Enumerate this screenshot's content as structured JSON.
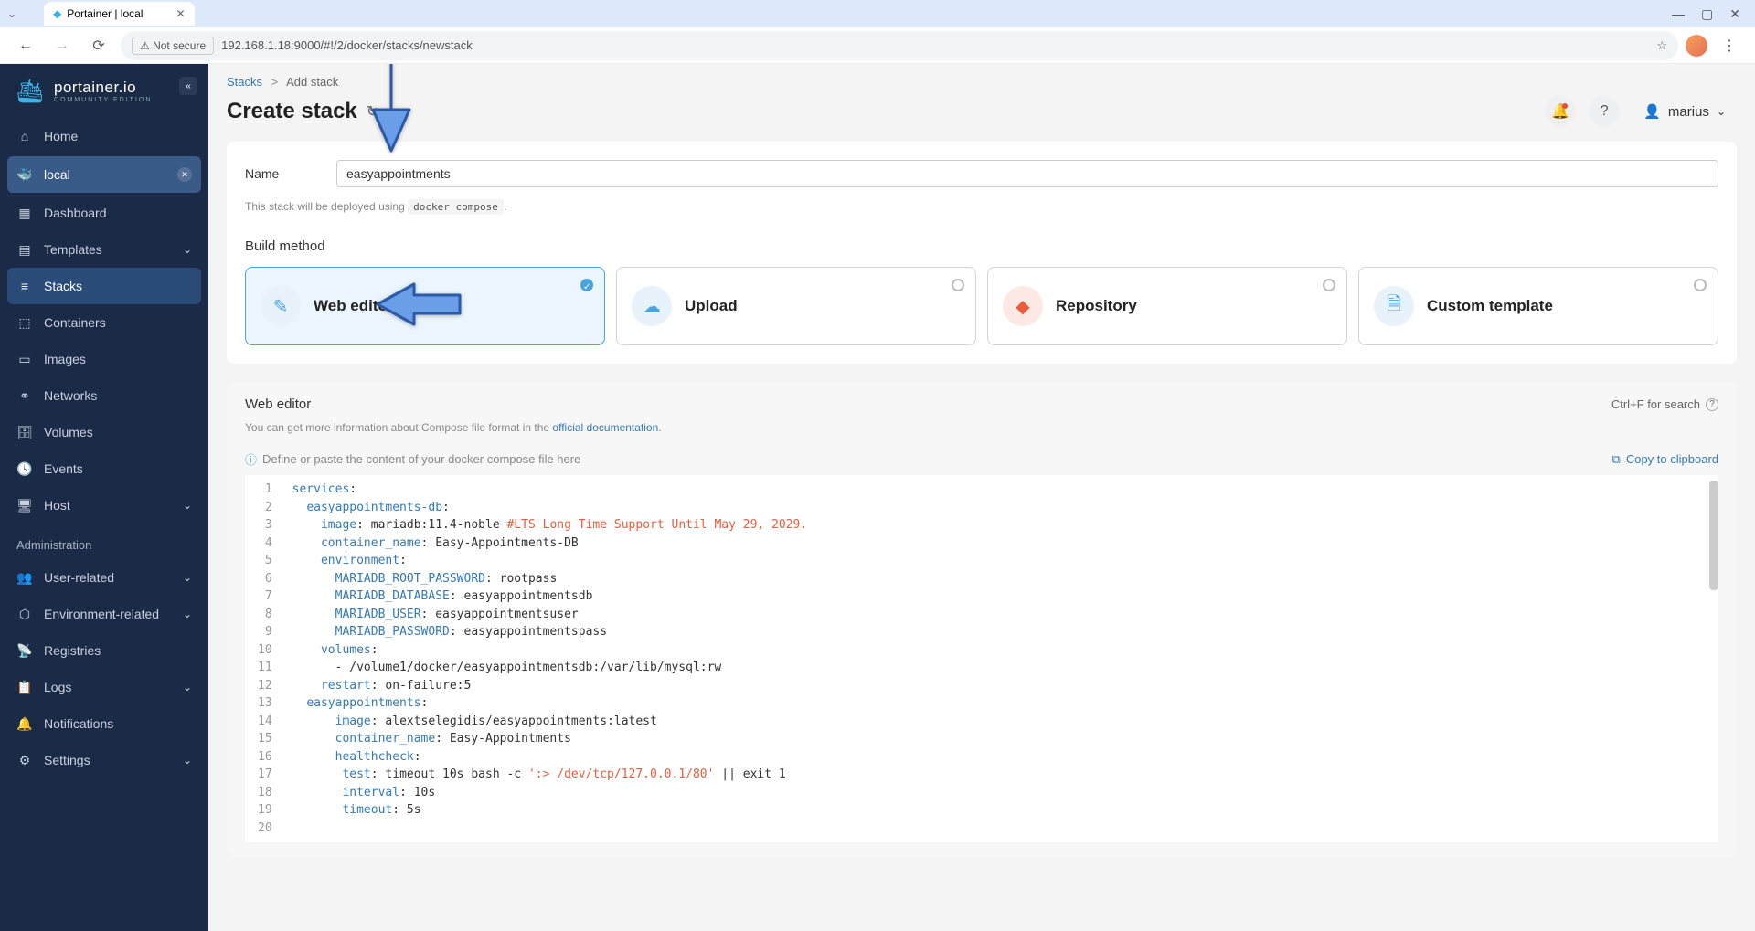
{
  "browser": {
    "tab_title": "Portainer | local",
    "url_label": "Not secure",
    "url": "192.168.1.18:9000/#!/2/docker/stacks/newstack"
  },
  "sidebar": {
    "logo_title": "portainer.io",
    "logo_subtitle": "COMMUNITY EDITION",
    "home": "Home",
    "local": "local",
    "items": [
      {
        "icon": "dashboard-icon",
        "label": "Dashboard"
      },
      {
        "icon": "templates-icon",
        "label": "Templates",
        "chevron": true
      },
      {
        "icon": "stacks-icon",
        "label": "Stacks",
        "active": true
      },
      {
        "icon": "containers-icon",
        "label": "Containers"
      },
      {
        "icon": "images-icon",
        "label": "Images"
      },
      {
        "icon": "networks-icon",
        "label": "Networks"
      },
      {
        "icon": "volumes-icon",
        "label": "Volumes"
      },
      {
        "icon": "events-icon",
        "label": "Events"
      },
      {
        "icon": "host-icon",
        "label": "Host",
        "chevron": true
      }
    ],
    "admin_title": "Administration",
    "admin": [
      {
        "icon": "user-icon",
        "label": "User-related",
        "chevron": true
      },
      {
        "icon": "env-icon",
        "label": "Environment-related",
        "chevron": true
      },
      {
        "icon": "registries-icon",
        "label": "Registries"
      },
      {
        "icon": "logs-icon",
        "label": "Logs",
        "chevron": true
      },
      {
        "icon": "notifications-icon",
        "label": "Notifications"
      },
      {
        "icon": "settings-icon",
        "label": "Settings",
        "chevron": true
      }
    ]
  },
  "breadcrumb": {
    "root": "Stacks",
    "current": "Add stack"
  },
  "page_title": "Create stack",
  "user_name": "marius",
  "form": {
    "name_label": "Name",
    "name_value": "easyappointments",
    "help_pre": "This stack will be deployed using",
    "help_code": "docker compose",
    "help_post": "."
  },
  "build": {
    "label": "Build method",
    "methods": [
      {
        "label": "Web editor",
        "icon": "edit-icon",
        "selected": true
      },
      {
        "label": "Upload",
        "icon": "upload-icon"
      },
      {
        "label": "Repository",
        "icon": "git-icon",
        "git": true
      },
      {
        "label": "Custom template",
        "icon": "template-icon"
      }
    ]
  },
  "editor": {
    "title": "Web editor",
    "search_hint": "Ctrl+F for search",
    "help_pre": "You can get more information about Compose file format in the ",
    "help_link": "official documentation",
    "info": "Define or paste the content of your docker compose file here",
    "copy": "Copy to clipboard",
    "code": [
      [
        {
          "t": "key",
          "v": "services"
        },
        {
          "t": "plain",
          "v": ":"
        }
      ],
      [
        {
          "t": "plain",
          "v": "  "
        },
        {
          "t": "key",
          "v": "easyappointments-db"
        },
        {
          "t": "plain",
          "v": ":"
        }
      ],
      [
        {
          "t": "plain",
          "v": "    "
        },
        {
          "t": "key",
          "v": "image"
        },
        {
          "t": "plain",
          "v": ": mariadb:11.4-noble "
        },
        {
          "t": "comment",
          "v": "#LTS Long Time Support Until May 29, 2029."
        }
      ],
      [
        {
          "t": "plain",
          "v": "    "
        },
        {
          "t": "key",
          "v": "container_name"
        },
        {
          "t": "plain",
          "v": ": Easy-Appointments-DB"
        }
      ],
      [
        {
          "t": "plain",
          "v": "    "
        },
        {
          "t": "key",
          "v": "environment"
        },
        {
          "t": "plain",
          "v": ":"
        }
      ],
      [
        {
          "t": "plain",
          "v": "      "
        },
        {
          "t": "key",
          "v": "MARIADB_ROOT_PASSWORD"
        },
        {
          "t": "plain",
          "v": ": rootpass"
        }
      ],
      [
        {
          "t": "plain",
          "v": "      "
        },
        {
          "t": "key",
          "v": "MARIADB_DATABASE"
        },
        {
          "t": "plain",
          "v": ": easyappointmentsdb"
        }
      ],
      [
        {
          "t": "plain",
          "v": "      "
        },
        {
          "t": "key",
          "v": "MARIADB_USER"
        },
        {
          "t": "plain",
          "v": ": easyappointmentsuser"
        }
      ],
      [
        {
          "t": "plain",
          "v": "      "
        },
        {
          "t": "key",
          "v": "MARIADB_PASSWORD"
        },
        {
          "t": "plain",
          "v": ": easyappointmentspass"
        }
      ],
      [
        {
          "t": "plain",
          "v": "    "
        },
        {
          "t": "key",
          "v": "volumes"
        },
        {
          "t": "plain",
          "v": ":"
        }
      ],
      [
        {
          "t": "plain",
          "v": "      - /volume1/docker/easyappointmentsdb:/var/lib/mysql:rw"
        }
      ],
      [
        {
          "t": "plain",
          "v": "    "
        },
        {
          "t": "key",
          "v": "restart"
        },
        {
          "t": "plain",
          "v": ": on-failure:5"
        }
      ],
      [
        {
          "t": "plain",
          "v": ""
        }
      ],
      [
        {
          "t": "plain",
          "v": "  "
        },
        {
          "t": "key",
          "v": "easyappointments"
        },
        {
          "t": "plain",
          "v": ":"
        }
      ],
      [
        {
          "t": "plain",
          "v": "      "
        },
        {
          "t": "key",
          "v": "image"
        },
        {
          "t": "plain",
          "v": ": alextselegidis/easyappointments:latest"
        }
      ],
      [
        {
          "t": "plain",
          "v": "      "
        },
        {
          "t": "key",
          "v": "container_name"
        },
        {
          "t": "plain",
          "v": ": Easy-Appointments"
        }
      ],
      [
        {
          "t": "plain",
          "v": "      "
        },
        {
          "t": "key",
          "v": "healthcheck"
        },
        {
          "t": "plain",
          "v": ":"
        }
      ],
      [
        {
          "t": "plain",
          "v": "       "
        },
        {
          "t": "key",
          "v": "test"
        },
        {
          "t": "plain",
          "v": ": timeout 10s bash -c "
        },
        {
          "t": "comment",
          "v": "':> /dev/tcp/127.0.0.1/80'"
        },
        {
          "t": "plain",
          "v": " || exit 1"
        }
      ],
      [
        {
          "t": "plain",
          "v": "       "
        },
        {
          "t": "key",
          "v": "interval"
        },
        {
          "t": "plain",
          "v": ": 10s"
        }
      ],
      [
        {
          "t": "plain",
          "v": "       "
        },
        {
          "t": "key",
          "v": "timeout"
        },
        {
          "t": "plain",
          "v": ": 5s"
        }
      ]
    ]
  }
}
